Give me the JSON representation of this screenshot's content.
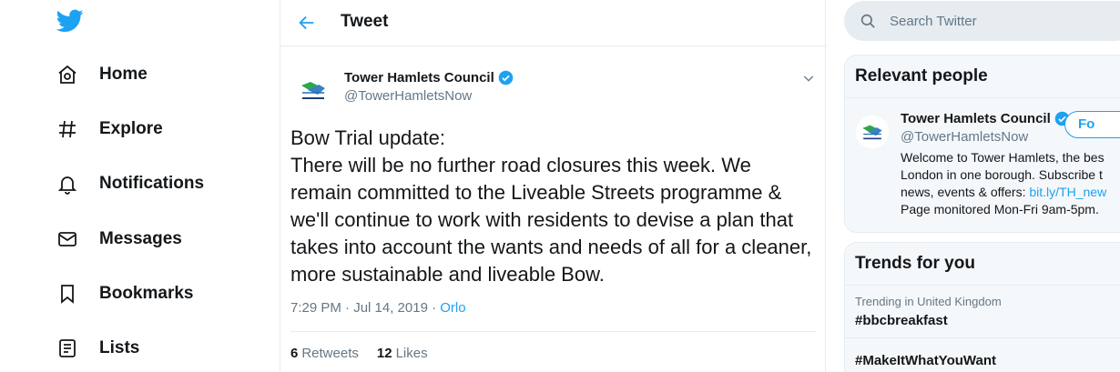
{
  "nav": {
    "items": [
      {
        "label": "Home",
        "icon": "home-icon"
      },
      {
        "label": "Explore",
        "icon": "hashtag-icon"
      },
      {
        "label": "Notifications",
        "icon": "bell-icon"
      },
      {
        "label": "Messages",
        "icon": "envelope-icon"
      },
      {
        "label": "Bookmarks",
        "icon": "bookmark-icon"
      },
      {
        "label": "Lists",
        "icon": "list-icon"
      }
    ]
  },
  "header": {
    "title": "Tweet"
  },
  "tweet": {
    "author_name": "Tower Hamlets Council",
    "author_handle": "@TowerHamletsNow",
    "text_lines": [
      "Bow Trial update:",
      "There will be no further road closures this week. We",
      "remain committed to the Liveable Streets programme &",
      "we'll continue to work with residents to devise a plan that",
      "takes into account the wants and needs of all for a cleaner,",
      "more sustainable and liveable Bow."
    ],
    "timestamp": "7:29 PM · Jul 14, 2019 · ",
    "source": "Orlo",
    "retweets_count": "6",
    "retweets_label": "Retweets",
    "likes_count": "12",
    "likes_label": "Likes"
  },
  "search": {
    "placeholder": "Search Twitter"
  },
  "relevant_people": {
    "title": "Relevant people",
    "name": "Tower Hamlets Council",
    "handle": "@TowerHamletsNow",
    "follow_label": "Fo",
    "bio_lines": [
      "Welcome to Tower Hamlets, the bes",
      "London in one borough. Subscribe t",
      "news, events & offers: ",
      "Page monitored Mon-Fri 9am-5pm."
    ],
    "bio_link": "bit.ly/TH_new"
  },
  "trends": {
    "title": "Trends for you",
    "items": [
      {
        "context": "Trending in United Kingdom",
        "name": "#bbcbreakfast"
      },
      {
        "context": "",
        "name": "#MakeItWhatYouWant"
      }
    ]
  },
  "colors": {
    "accent": "#1da1f2",
    "text": "#14171a",
    "secondary": "#657786",
    "border": "#e6ecf0"
  }
}
